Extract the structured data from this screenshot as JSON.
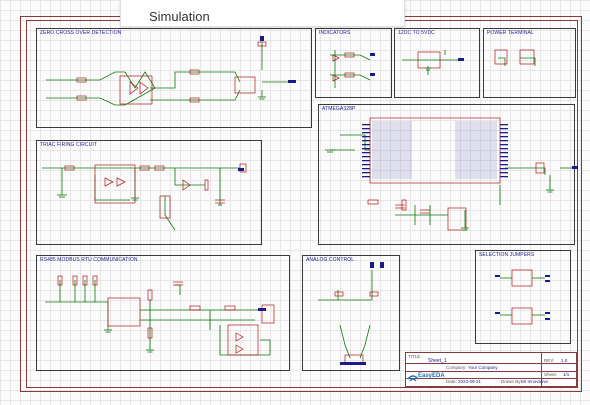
{
  "tab": {
    "label": "Simulation"
  },
  "blocks": {
    "zero_cross": "ZERO CROSS OVER DETECTION",
    "indicators": "INDICATORS",
    "dc": "12DC TO 5VDC",
    "power_terminal": "POWER TERMINAL",
    "triac": "TRIAC FIRING CIRCUIT",
    "atmega": "ATMEGA328P",
    "rs485": "RS485 MODBUS RTU COMMUNICATION",
    "analog": "ANALOG CONTROL",
    "jumpers": "SELECTION JUMPERS"
  },
  "title_block": {
    "title_label": "TITLE:",
    "title_value": "Sheet_1",
    "rev_label": "REV:",
    "rev_value": "1.0",
    "company_label": "Company:",
    "company_value": "Your Company",
    "sheet_label": "Sheet:",
    "sheet_value": "1/1",
    "date_label": "Date:",
    "date_value": "2023-09-21",
    "drawn_label": "Drawn By:",
    "drawn_value": "Mr Innovative",
    "logo_text": "EasyEDA"
  },
  "colors": {
    "wire": "#0a7a0a",
    "component": "#b01818",
    "pin": "#1a1a8a",
    "frame": "#8a3a3a"
  }
}
